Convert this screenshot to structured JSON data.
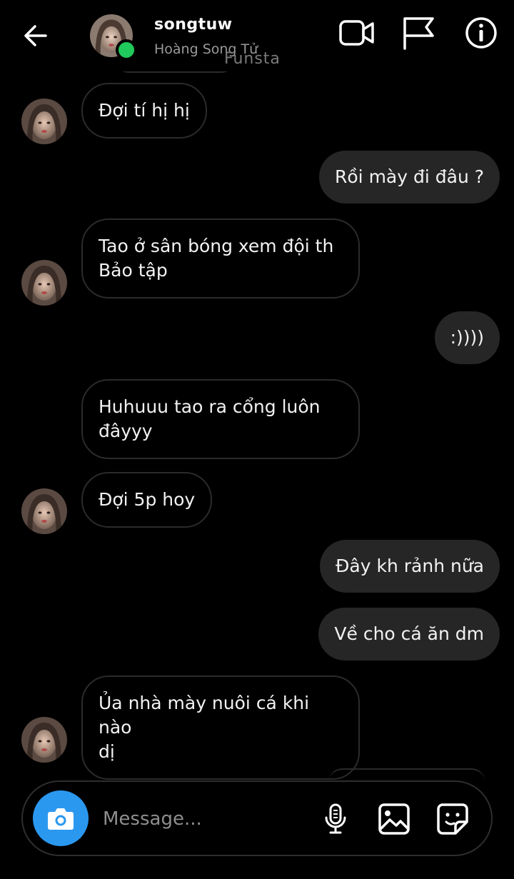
{
  "header": {
    "username": "songtuw",
    "display_name": "Hoàng Song Tử",
    "watermark": "Funsta"
  },
  "messages": [
    {
      "side": "in",
      "text": "Đợi tí hị hị"
    },
    {
      "side": "out",
      "text": "Rồi mày đi đâu ?"
    },
    {
      "side": "in",
      "text": "Tao ở sân bóng xem đội th\nBảo tập"
    },
    {
      "side": "out",
      "text": ":))))"
    },
    {
      "side": "in",
      "text": "Huhuuu tao ra cổng luôn\nđâyyy"
    },
    {
      "side": "in",
      "text": "Đợi 5p hoy"
    },
    {
      "side": "out",
      "text": "Đây kh rảnh nữa"
    },
    {
      "side": "out",
      "text": "Về cho cá ăn dm"
    },
    {
      "side": "in",
      "text": "Ủa nhà mày nuôi cá khi nào\ndị"
    }
  ],
  "composer": {
    "placeholder": "Message..."
  },
  "colors": {
    "background": "#000000",
    "outgoing_bubble": "#262626",
    "incoming_border": "#2b2b2b",
    "camera_button": "#2b98f0",
    "online_dot": "#1fc95b"
  },
  "icons": [
    "back-arrow-icon",
    "video-call-icon",
    "flag-icon",
    "info-icon",
    "camera-icon",
    "microphone-icon",
    "gallery-icon",
    "sticker-icon"
  ]
}
